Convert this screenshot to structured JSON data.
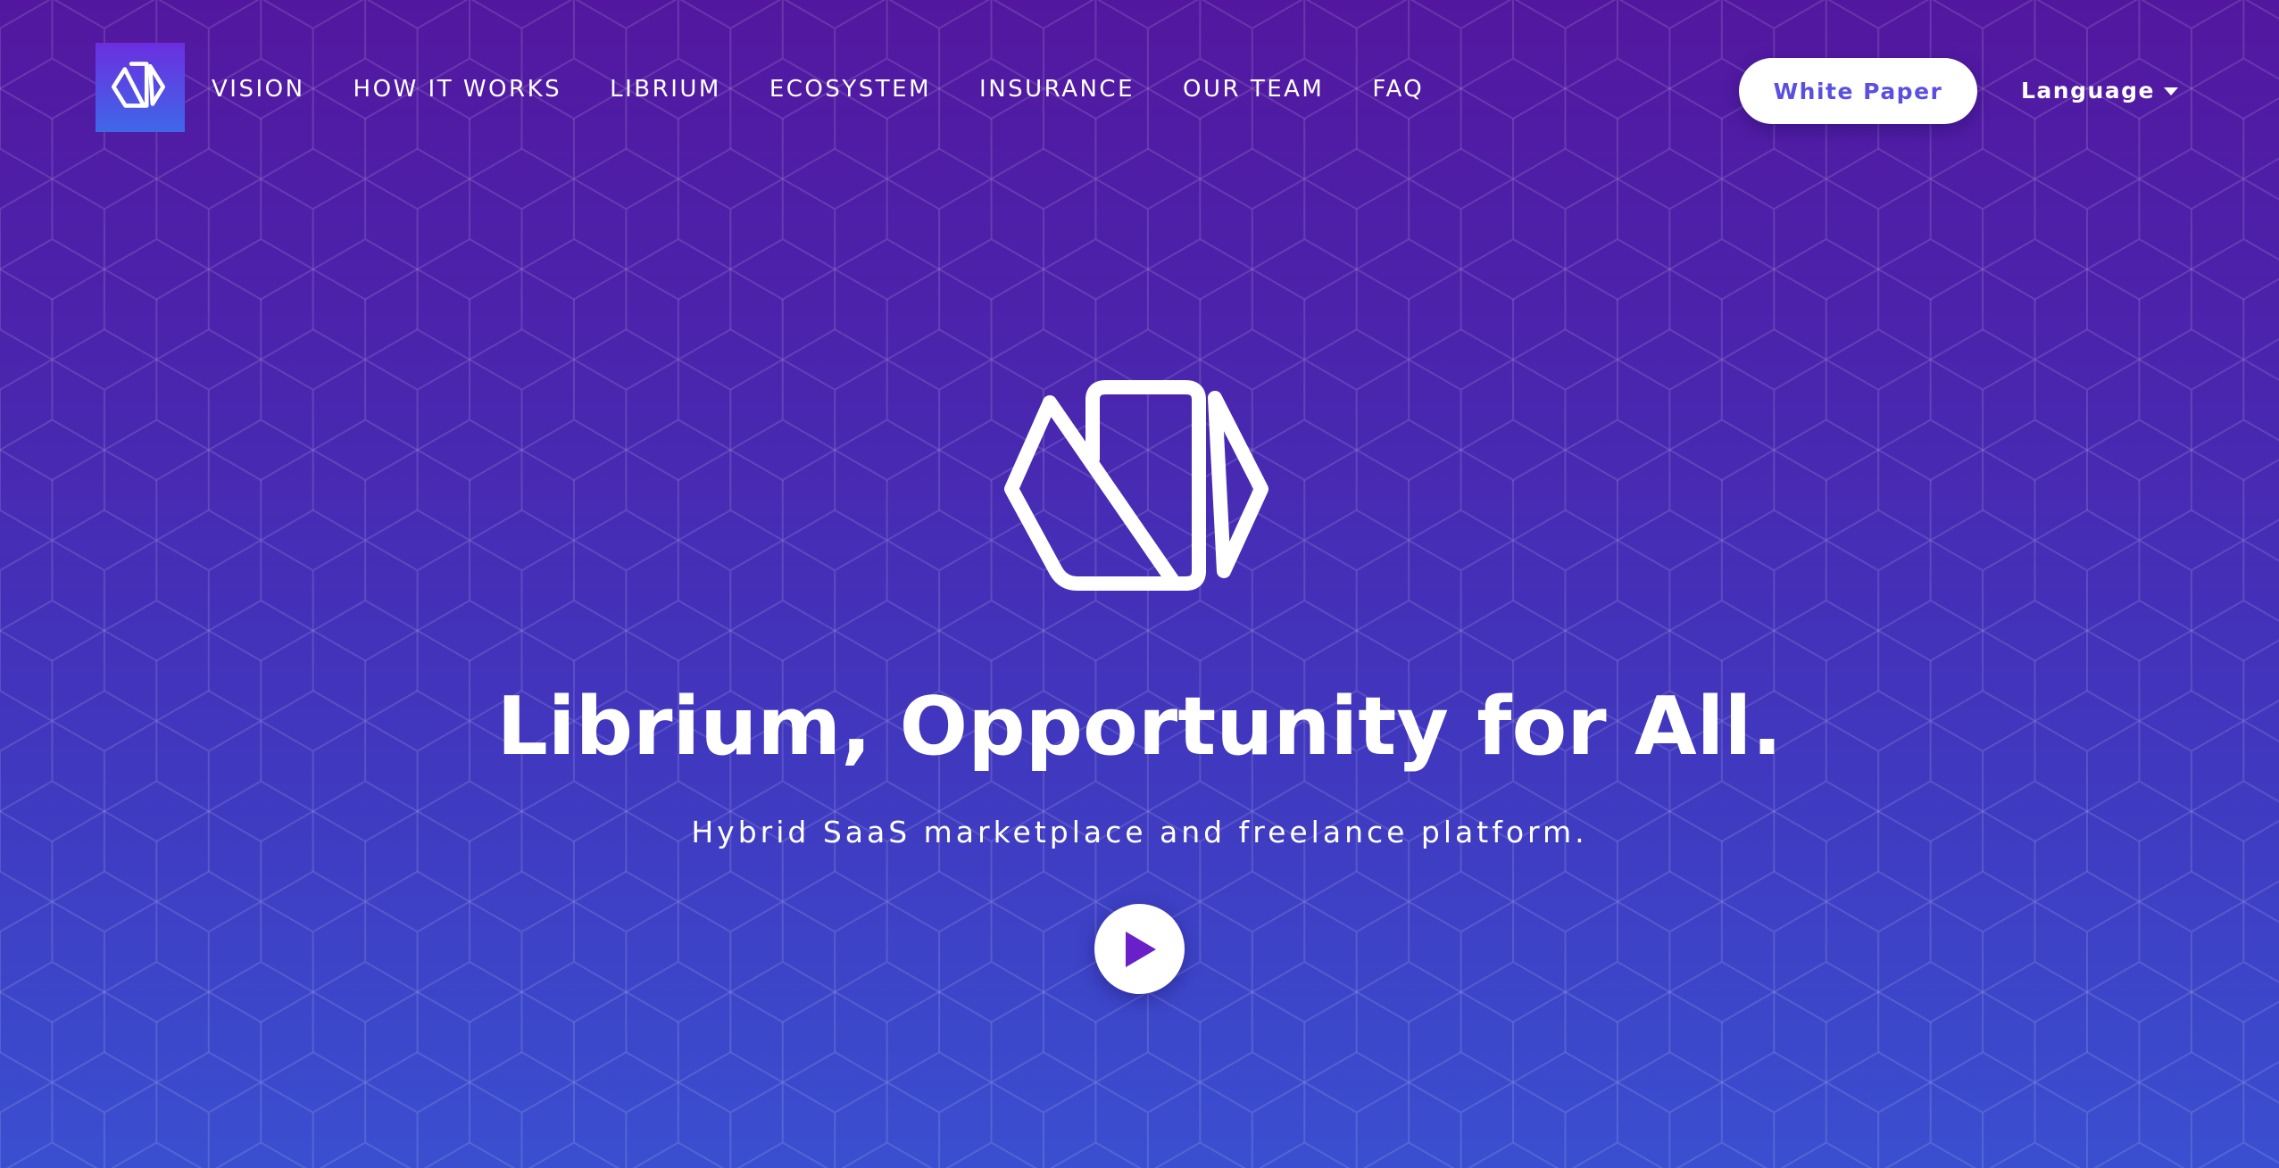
{
  "header": {
    "logo_icon": "librium-logo-icon",
    "nav": [
      {
        "label": "VISION"
      },
      {
        "label": "HOW IT WORKS"
      },
      {
        "label": "LIBRIUM"
      },
      {
        "label": "ECOSYSTEM"
      },
      {
        "label": "INSURANCE"
      },
      {
        "label": "OUR TEAM"
      },
      {
        "label": "FAQ"
      }
    ],
    "white_paper_label": "White Paper",
    "language_label": "Language",
    "language_icon": "caret-down-icon"
  },
  "hero": {
    "logo_icon": "librium-logo-icon",
    "headline": "Librium, Opportunity for All.",
    "subheadline": "Hybrid SaaS marketplace and freelance platform.",
    "play_icon": "play-icon"
  },
  "colors": {
    "gradient_top": "#53179f",
    "gradient_bottom": "#3a4fd0",
    "logo_box_top": "#6b2fe0",
    "logo_box_bottom": "#3f67e8",
    "button_text": "#5a4fe0",
    "play_triangle": "#6a20c8",
    "text": "#ffffff"
  }
}
